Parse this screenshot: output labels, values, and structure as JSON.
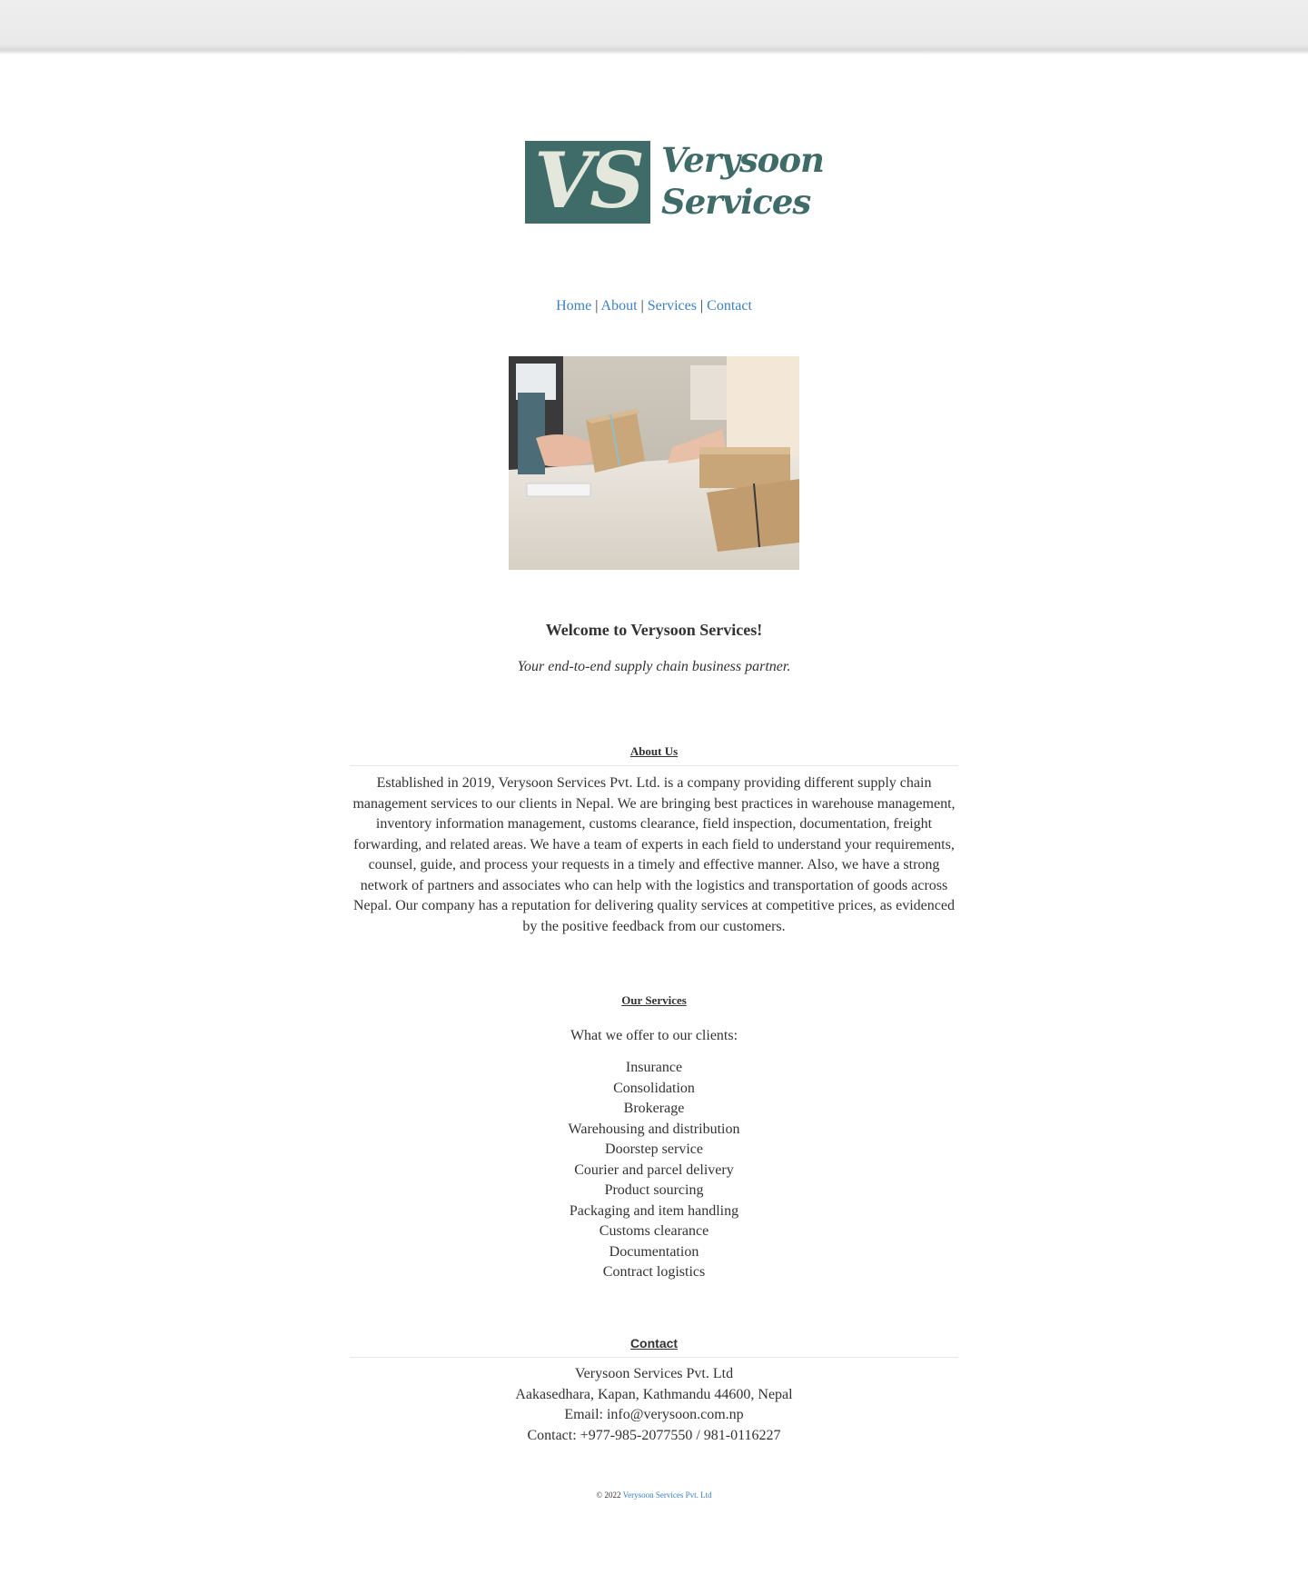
{
  "brand": {
    "monogram": "VS",
    "name_line1": "Verysoon",
    "name_line2": "Services",
    "color": "#3f6b68"
  },
  "nav": {
    "items": [
      "Home",
      "About",
      "Services",
      "Contact"
    ],
    "separator": "|"
  },
  "hero": {
    "alt": "Hands passing a parcel"
  },
  "welcome": {
    "title": "Welcome to Verysoon Services!",
    "tagline": "Your end-to-end supply chain business partner."
  },
  "about": {
    "heading": "About Us",
    "body": "Established in 2019, Verysoon Services Pvt. Ltd. is a company providing different supply chain management services to our clients in Nepal. We are bringing best practices in warehouse management, inventory information management, customs clearance, field inspection, documentation, freight forwarding, and related areas. We have a team of experts in each field to understand your requirements, counsel, guide, and process your requests in a timely and effective manner. Also, we have a strong network of partners and associates who can help with the logistics and transportation of goods across Nepal. Our company has a reputation for delivering quality services at competitive prices, as evidenced by the positive feedback from our customers."
  },
  "services": {
    "heading": "Our Services",
    "intro": "What we offer to our clients:",
    "items": [
      "Insurance",
      "Consolidation",
      "Brokerage",
      "Warehousing and distribution",
      "Doorstep service",
      "Courier and parcel delivery",
      "Product sourcing",
      "Packaging and item handling",
      "Customs clearance",
      "Documentation",
      "Contract logistics"
    ]
  },
  "contact": {
    "heading": "Contact",
    "company": "Verysoon Services Pvt. Ltd",
    "address": "Aakasedhara, Kapan, Kathmandu 44600, Nepal",
    "email": "Email: info@verysoon.com.np",
    "phone": "Contact: +977-985-2077550 / 981-0116227"
  },
  "footer": {
    "copyright": "© 2022",
    "link": "Verysoon Services Pvt. Ltd"
  }
}
